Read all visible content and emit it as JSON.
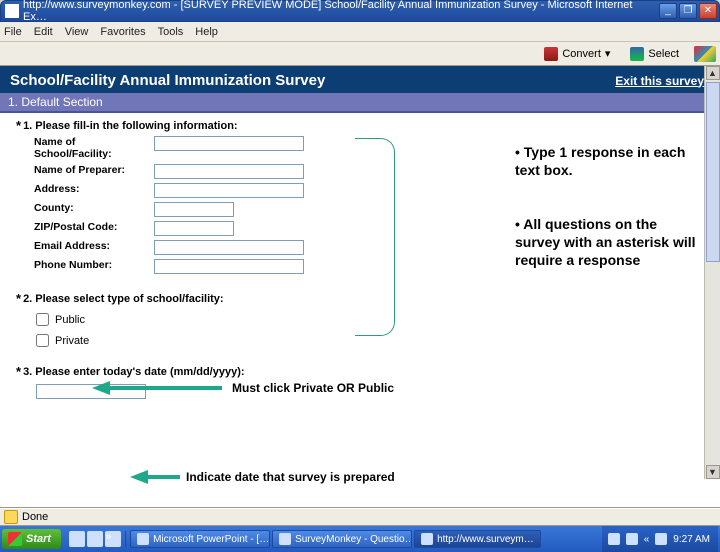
{
  "window": {
    "title": "http://www.surveymonkey.com - [SURVEY PREVIEW MODE] School/Facility Annual Immunization Survey - Microsoft Internet Ex…"
  },
  "menu": {
    "items": [
      "File",
      "Edit",
      "View",
      "Favorites",
      "Tools",
      "Help"
    ]
  },
  "toolbar": {
    "convert_label": "Convert",
    "select_label": "Select"
  },
  "survey": {
    "title": "School/Facility Annual Immunization Survey",
    "exit_label": "Exit this survey",
    "section_title": "1. Default Section",
    "q1": {
      "text": "1. Please fill-in the following information:",
      "fields": [
        {
          "label": "Name of School/Facility:"
        },
        {
          "label": "Name of Preparer:"
        },
        {
          "label": "Address:"
        },
        {
          "label": "County:",
          "short": true
        },
        {
          "label": "ZIP/Postal Code:",
          "short": true
        },
        {
          "label": "Email Address:"
        },
        {
          "label": "Phone Number:"
        }
      ]
    },
    "q2": {
      "text": "2. Please select type of school/facility:",
      "options": [
        "Public",
        "Private"
      ]
    },
    "q3": {
      "text": "3. Please enter today's date (mm/dd/yyyy):"
    }
  },
  "annotations": {
    "a1": "• Type 1 response in each text box.",
    "a2": "• All questions on the survey with an asterisk will require a response",
    "a_private": "Must click Private OR Public",
    "a_date": "Indicate date that survey is prepared"
  },
  "status": {
    "text": "Done"
  },
  "taskbar": {
    "start": "Start",
    "tasks": [
      "Microsoft PowerPoint - […",
      "SurveyMonkey - Questio…",
      "http://www.surveym…"
    ],
    "time": "9:27 AM"
  }
}
